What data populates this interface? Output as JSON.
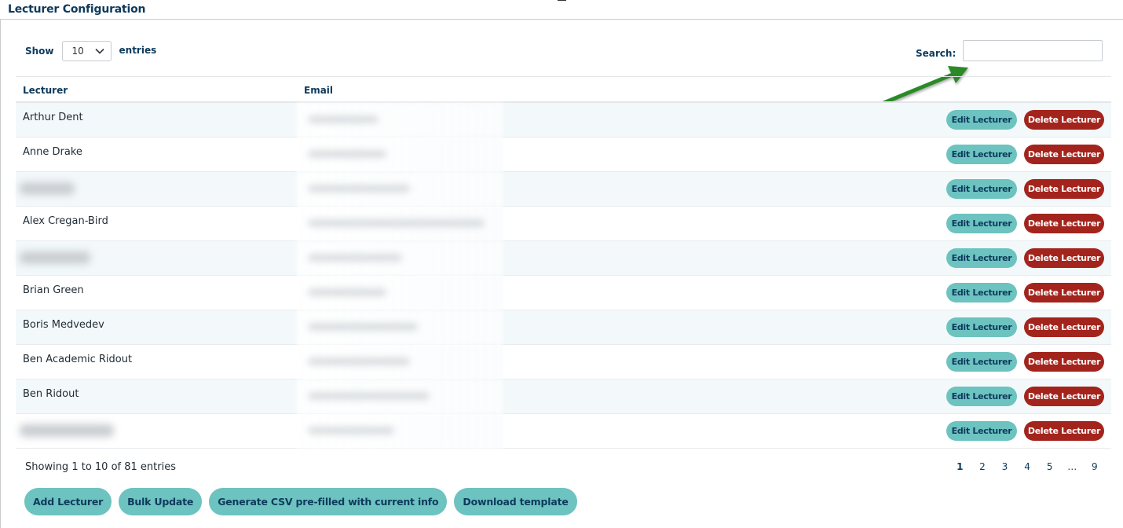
{
  "page": {
    "title": "Lecturer Configuration"
  },
  "length_control": {
    "show_label": "Show",
    "value": "10",
    "entries_label": "entries"
  },
  "search": {
    "label": "Search:",
    "value": "",
    "placeholder": ""
  },
  "table": {
    "headers": [
      "Lecturer",
      "Email",
      ""
    ],
    "rows": [
      {
        "name": "Arthur Dent",
        "edit_label": "Edit Lecturer",
        "delete_label": "Delete Lecturer"
      },
      {
        "name": "Anne Drake",
        "edit_label": "Edit Lecturer",
        "delete_label": "Delete Lecturer"
      },
      {
        "name": "",
        "edit_label": "Edit Lecturer",
        "delete_label": "Delete Lecturer"
      },
      {
        "name": "Alex Cregan-Bird",
        "edit_label": "Edit Lecturer",
        "delete_label": "Delete Lecturer"
      },
      {
        "name": "",
        "edit_label": "Edit Lecturer",
        "delete_label": "Delete Lecturer"
      },
      {
        "name": "Brian Green",
        "edit_label": "Edit Lecturer",
        "delete_label": "Delete Lecturer"
      },
      {
        "name": "Boris Medvedev",
        "edit_label": "Edit Lecturer",
        "delete_label": "Delete Lecturer"
      },
      {
        "name": "Ben Academic Ridout",
        "edit_label": "Edit Lecturer",
        "delete_label": "Delete Lecturer"
      },
      {
        "name": "Ben Ridout",
        "edit_label": "Edit Lecturer",
        "delete_label": "Delete Lecturer"
      },
      {
        "name": "",
        "edit_label": "Edit Lecturer",
        "delete_label": "Delete Lecturer"
      }
    ]
  },
  "footer": {
    "info": "Showing 1 to 10 of 81 entries",
    "pages": [
      "1",
      "2",
      "3",
      "4",
      "5",
      "…",
      "9"
    ],
    "current_page": "1"
  },
  "actions": {
    "add": "Add Lecturer",
    "bulk": "Bulk Update",
    "csv": "Generate CSV pre-filled with current info",
    "template": "Download template"
  },
  "colors": {
    "accent_teal": "#6cc3c0",
    "danger_red": "#a3241c",
    "heading_navy": "#0e3a5c",
    "annotation_arrow": "#2a8a25"
  },
  "icons": {
    "select_chevron": "chevron-down-icon",
    "annotation": "arrow-annotation-icon"
  }
}
